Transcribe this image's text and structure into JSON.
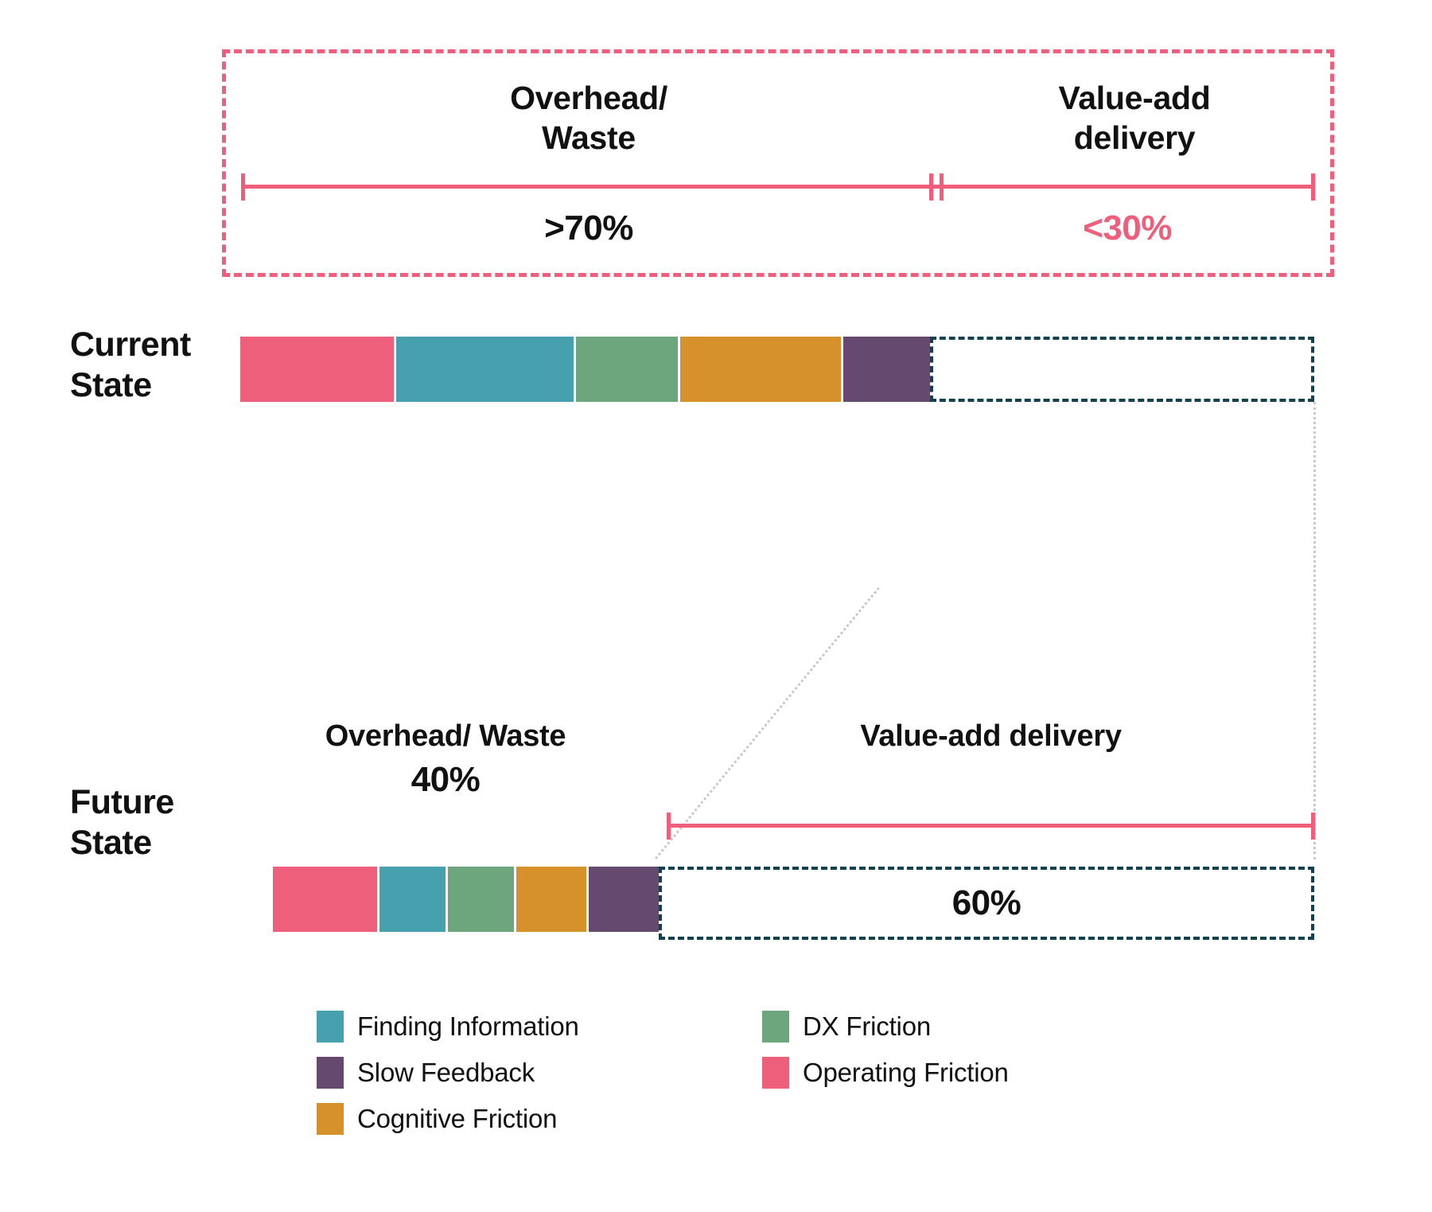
{
  "colors": {
    "pink_accent": "#ef5f7c",
    "dark_teal": "#12414f",
    "operating_friction": "#ee5f7b",
    "finding_information": "#46a0ae",
    "dx_friction": "#6da67c",
    "cognitive_friction": "#d7912b",
    "slow_feedback": "#65496f",
    "connector_grey": "#c9c9c9",
    "text": "#111111"
  },
  "callout": {
    "overhead_label": "Overhead/\nWaste",
    "overhead_label_line1": "Overhead/",
    "overhead_label_line2": "Waste",
    "valueadd_label_line1": "Value-add",
    "valueadd_label_line2": "delivery",
    "overhead_percent": ">70%",
    "valueadd_percent": "<30%"
  },
  "rows": [
    {
      "name": "current-state",
      "label_line1": "Current",
      "label_line2": "State",
      "segments": [
        {
          "key": "operating_friction",
          "label": "Operating Friction",
          "color": "#ee5f7b",
          "width_pct": 12.1
        },
        {
          "key": "finding_information",
          "label": "Finding Information",
          "color": "#46a0ae",
          "width_pct": 16.4
        },
        {
          "key": "dx_friction",
          "label": "DX Friction",
          "color": "#6da67c",
          "width_pct": 9.8
        },
        {
          "key": "cognitive_friction",
          "label": "Cognitive Friction",
          "color": "#d7912b",
          "width_pct": 15.3
        },
        {
          "key": "slow_feedback",
          "label": "Slow Feedback",
          "color": "#65496f",
          "width_pct": 9.4
        }
      ],
      "waste_total_pct": 70,
      "value_add_pct": 30,
      "value_add_text": ""
    },
    {
      "name": "future-state",
      "label_line1": "Future",
      "label_line2": "State",
      "segments": [
        {
          "key": "operating_friction",
          "label": "Operating Friction",
          "color": "#ee5f7b",
          "width_pct": 9.7
        },
        {
          "key": "finding_information",
          "label": "Finding Information",
          "color": "#46a0ae",
          "width_pct": 6.2
        },
        {
          "key": "dx_friction",
          "label": "DX Friction",
          "color": "#6da67c",
          "width_pct": 6.2
        },
        {
          "key": "cognitive_friction",
          "label": "Cognitive Friction",
          "color": "#d7912b",
          "width_pct": 6.6
        },
        {
          "key": "slow_feedback",
          "label": "Slow Feedback",
          "color": "#65496f",
          "width_pct": 6.8
        }
      ],
      "waste_total_pct": 40,
      "value_add_pct": 60,
      "value_add_text": "60%"
    }
  ],
  "future_headings": {
    "overhead_label": "Overhead/ Waste",
    "overhead_percent": "40%",
    "valueadd_label": "Value-add delivery",
    "valueadd_percent": "60%"
  },
  "legend": {
    "left_column": [
      {
        "label": "Finding Information",
        "color": "#46a0ae"
      },
      {
        "label": "Slow Feedback",
        "color": "#65496f"
      },
      {
        "label": "Cognitive Friction",
        "color": "#d7912b"
      }
    ],
    "right_column": [
      {
        "label": "DX Friction",
        "color": "#6da67c"
      },
      {
        "label": "Operating Friction",
        "color": "#ee5f7b"
      }
    ]
  },
  "chart_data": {
    "type": "bar",
    "title": "",
    "orientation": "horizontal-stacked",
    "categories": [
      "Current State",
      "Future State"
    ],
    "series": [
      {
        "name": "Operating Friction",
        "values": [
          16,
          13
        ],
        "color": "#ee5f7b"
      },
      {
        "name": "Finding Information",
        "values": [
          22,
          8
        ],
        "color": "#46a0ae"
      },
      {
        "name": "DX Friction",
        "values": [
          13,
          8
        ],
        "color": "#6da67c"
      },
      {
        "name": "Cognitive Friction",
        "values": [
          21,
          9
        ],
        "color": "#d7912b"
      },
      {
        "name": "Slow Feedback",
        "values": [
          13,
          9
        ],
        "color": "#65496f"
      },
      {
        "name": "Value-add delivery",
        "values": [
          30,
          60
        ],
        "color": "#ffffff"
      }
    ],
    "annotations": [
      "Overhead/ Waste >70%",
      "Value-add delivery <30%",
      "Overhead/ Waste 40%",
      "Value-add delivery 60%"
    ],
    "xlabel": "",
    "ylabel": "",
    "xlim": [
      0,
      100
    ],
    "grid": false,
    "legend_position": "bottom"
  }
}
